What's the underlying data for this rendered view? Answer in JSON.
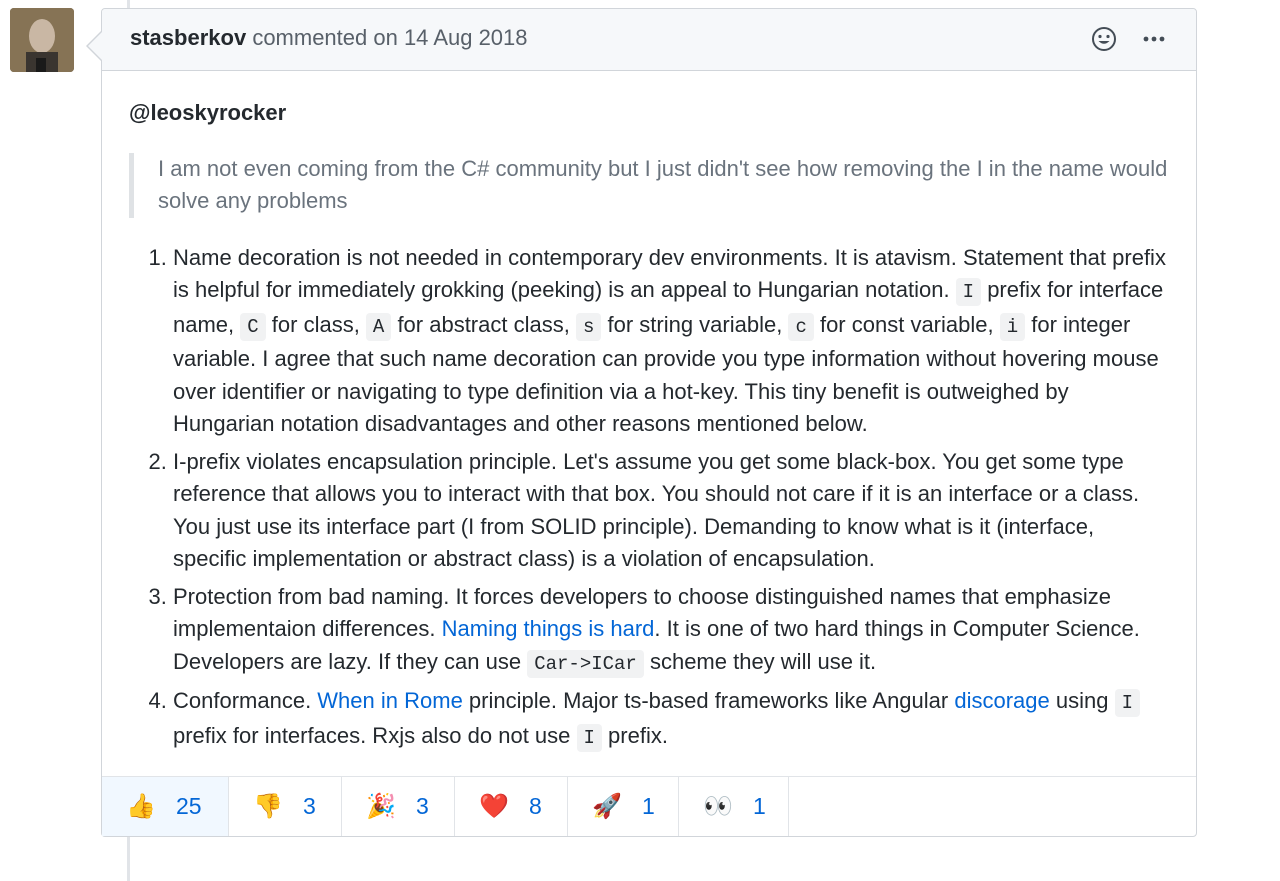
{
  "comment": {
    "author": "stasberkov",
    "action_text": "commented on 14 Aug 2018",
    "mention": "@leoskyrocker",
    "quote": "I am not even coming from the C# community but I just didn't see how removing the I in the name would solve any problems",
    "items": [
      {
        "parts": [
          {
            "t": "Name decoration is not needed in contemporary dev environments. It is atavism. Statement that prefix is helpful for immediately grokking (peeking) is an appeal to Hungarian notation. "
          },
          {
            "c": "I"
          },
          {
            "t": " prefix for interface name, "
          },
          {
            "c": "C"
          },
          {
            "t": " for class, "
          },
          {
            "c": "A"
          },
          {
            "t": " for abstract class, "
          },
          {
            "c": "s"
          },
          {
            "t": " for string variable, "
          },
          {
            "c": "c"
          },
          {
            "t": " for const variable, "
          },
          {
            "c": "i"
          },
          {
            "t": " for integer variable. I agree that such name decoration can provide you type information without hovering mouse over identifier or navigating to type definition via a hot-key. This tiny benefit is outweighed by Hungarian notation disadvantages and other reasons mentioned below."
          }
        ]
      },
      {
        "parts": [
          {
            "t": "I-prefix violates encapsulation principle. Let's assume you get some black-box. You get some type reference that allows you to interact with that box. You should not care if it is an interface or a class. You just use its interface part (I from SOLID principle). Demanding to know what is it (interface, specific implementation or abstract class) is a violation of encapsulation."
          }
        ]
      },
      {
        "parts": [
          {
            "t": "Protection from bad naming. It forces developers to choose distinguished names that emphasize implementaion differences. "
          },
          {
            "a": "Naming things is hard"
          },
          {
            "t": ". It is one of two hard things in Computer Science. Developers are lazy. If they can use "
          },
          {
            "c": "Car->ICar"
          },
          {
            "t": " scheme they will use it."
          }
        ]
      },
      {
        "parts": [
          {
            "t": "Conformance. "
          },
          {
            "a": "When in Rome"
          },
          {
            "t": " principle. Major ts-based frameworks like Angular "
          },
          {
            "a": "discorage"
          },
          {
            "t": " using "
          },
          {
            "c": "I"
          },
          {
            "t": " prefix for interfaces. Rxjs also do not use "
          },
          {
            "c": "I"
          },
          {
            "t": " prefix."
          }
        ]
      }
    ]
  },
  "reactions": [
    {
      "emoji": "👍",
      "name": "thumbs-up-icon",
      "count": "25",
      "active": true
    },
    {
      "emoji": "👎",
      "name": "thumbs-down-icon",
      "count": "3",
      "active": false
    },
    {
      "emoji": "🎉",
      "name": "party-popper-icon",
      "count": "3",
      "active": false
    },
    {
      "emoji": "❤️",
      "name": "heart-icon",
      "count": "8",
      "active": false
    },
    {
      "emoji": "🚀",
      "name": "rocket-icon",
      "count": "1",
      "active": false
    },
    {
      "emoji": "👀",
      "name": "eyes-icon",
      "count": "1",
      "active": false
    }
  ],
  "colors": {
    "link": "#0366d6",
    "muted": "#586069",
    "quote": "#6a737d"
  }
}
